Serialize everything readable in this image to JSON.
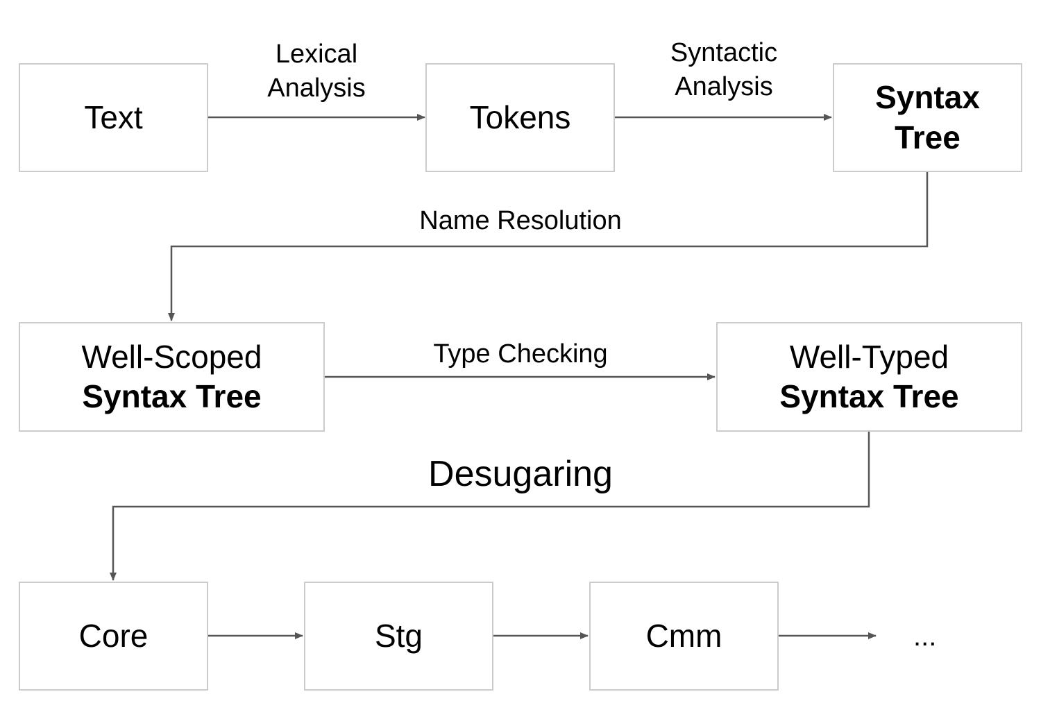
{
  "nodes": {
    "text": {
      "line1": "Text",
      "line2": ""
    },
    "tokens": {
      "line1": "Tokens",
      "line2": ""
    },
    "syntax_tree": {
      "line1": "Syntax",
      "line2": "Tree"
    },
    "well_scoped": {
      "line1": "Well-Scoped",
      "line2": "Syntax Tree"
    },
    "well_typed": {
      "line1": "Well-Typed",
      "line2": "Syntax Tree"
    },
    "core": {
      "line1": "Core"
    },
    "stg": {
      "line1": "Stg"
    },
    "cmm": {
      "line1": "Cmm"
    },
    "more": {
      "line1": "..."
    }
  },
  "edges": {
    "lexical": {
      "line1": "Lexical",
      "line2": "Analysis"
    },
    "syntactic": {
      "line1": "Syntactic",
      "line2": "Analysis"
    },
    "name_resolution": {
      "line1": "Name Resolution"
    },
    "type_checking": {
      "line1": "Type Checking"
    },
    "desugaring": {
      "line1": "Desugaring"
    }
  },
  "colors": {
    "box_border": "#cccccc",
    "arrow": "#555555"
  }
}
